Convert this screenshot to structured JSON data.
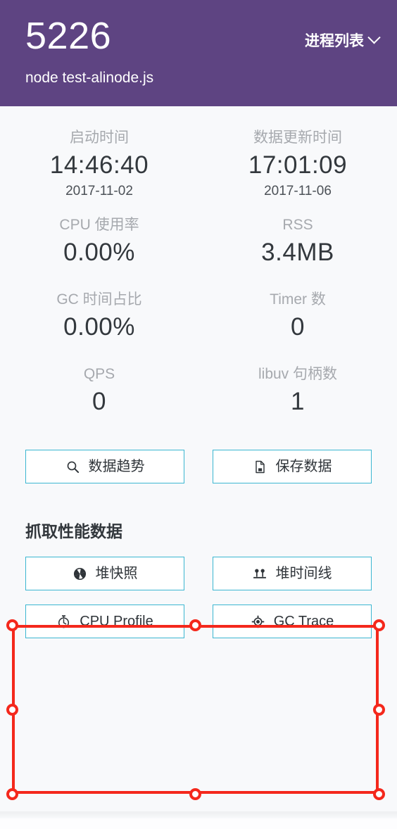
{
  "header": {
    "pid": "5226",
    "process_name": "node test-alinode.js",
    "process_list_label": "进程列表",
    "chevron_icon": "chevron-down-icon",
    "background_color": "#5e4482"
  },
  "metrics": [
    [
      {
        "label": "启动时间",
        "value": "14:46:40",
        "sub": "2017-11-02"
      },
      {
        "label": "数据更新时间",
        "value": "17:01:09",
        "sub": "2017-11-06"
      }
    ],
    [
      {
        "label": "CPU 使用率",
        "value": "0.00%",
        "sub": ""
      },
      {
        "label": "RSS",
        "value": "3.4MB",
        "sub": ""
      }
    ],
    [
      {
        "label": "GC 时间占比",
        "value": "0.00%",
        "sub": ""
      },
      {
        "label": "Timer 数",
        "value": "0",
        "sub": ""
      }
    ],
    [
      {
        "label": "QPS",
        "value": "0",
        "sub": ""
      },
      {
        "label": "libuv 句柄数",
        "value": "1",
        "sub": ""
      }
    ]
  ],
  "actions": {
    "accent_color": "#3bb6d1",
    "buttons": [
      {
        "label": "数据趋势",
        "icon": "search-icon"
      },
      {
        "label": "保存数据",
        "icon": "save-file-icon"
      }
    ]
  },
  "capture": {
    "title": "抓取性能数据",
    "buttons": [
      {
        "label": "堆快照",
        "icon": "aperture-icon"
      },
      {
        "label": "堆时间线",
        "icon": "timeline-icon"
      },
      {
        "label": "CPU Profile",
        "icon": "stopwatch-icon"
      },
      {
        "label": "GC Trace",
        "icon": "crosshair-icon"
      }
    ]
  },
  "selection": {
    "color": "#f4281c",
    "handle_count": 8
  }
}
